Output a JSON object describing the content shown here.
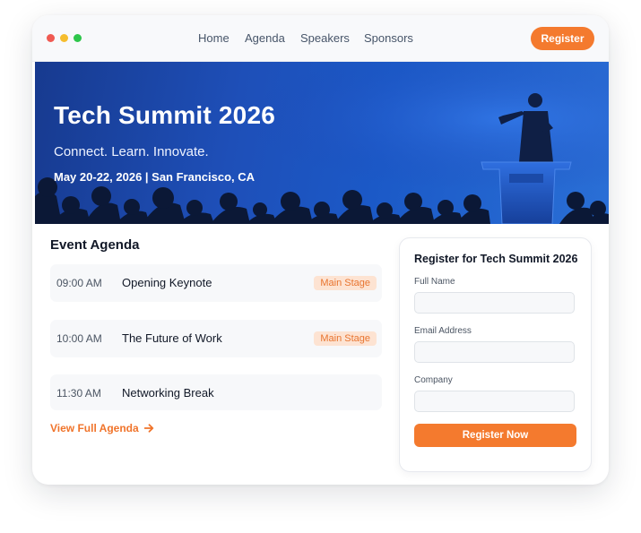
{
  "window": {
    "controls": [
      "close",
      "minimize",
      "maximize"
    ]
  },
  "nav": {
    "items": [
      {
        "label": "Home"
      },
      {
        "label": "Agenda"
      },
      {
        "label": "Speakers"
      },
      {
        "label": "Sponsors"
      }
    ],
    "register_label": "Register"
  },
  "hero": {
    "title": "Tech Summit 2026",
    "tagline": "Connect. Learn. Innovate.",
    "date_location": "May 20-22, 2026 | San Francisco, CA"
  },
  "agenda": {
    "title": "Event Agenda",
    "items": [
      {
        "time": "09:00 AM",
        "name": "Opening Keynote",
        "badge": "Main Stage"
      },
      {
        "time": "10:00 AM",
        "name": "The Future of Work",
        "badge": "Main Stage"
      },
      {
        "time": "11:30 AM",
        "name": "Networking Break",
        "badge": ""
      }
    ],
    "view_all_label": "View Full Agenda",
    "view_all_icon": "arrow-right-icon"
  },
  "registration": {
    "title": "Register for Tech Summit 2026",
    "fields": [
      {
        "label": "Full Name",
        "value": "",
        "placeholder": ""
      },
      {
        "label": "Email Address",
        "value": "",
        "placeholder": ""
      },
      {
        "label": "Company",
        "value": "",
        "placeholder": ""
      }
    ],
    "submit_label": "Register Now"
  },
  "colors": {
    "accent": "#f47a2e",
    "hero_blue": "#1e4fb8",
    "badge_bg": "#fde3d2"
  }
}
